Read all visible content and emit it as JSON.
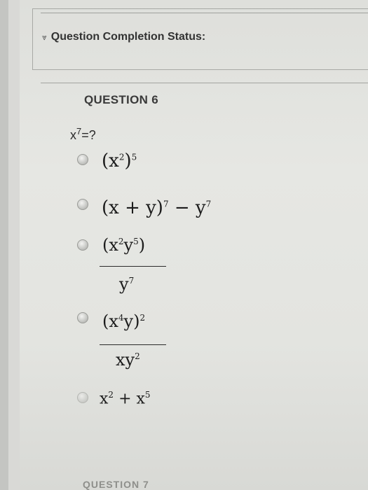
{
  "status": {
    "label": "Question Completion Status:",
    "icon": "chevron-double-down-icon"
  },
  "question": {
    "title": "QUESTION 6",
    "prompt_base": "x",
    "prompt_exp": "7",
    "prompt_tail": "=?"
  },
  "options": [
    {
      "type": "power",
      "base": "(x",
      "inner_exp": "2",
      "close": ")",
      "outer_exp": "5"
    },
    {
      "type": "expr",
      "parts": [
        "(x + y)",
        "7",
        "−",
        "y",
        "7"
      ]
    },
    {
      "type": "fraction",
      "numerator": [
        "(x",
        "2",
        "y",
        "5",
        ")"
      ],
      "denominator": [
        "y",
        "7"
      ]
    },
    {
      "type": "fraction",
      "numerator": [
        "(x",
        "4",
        "y)",
        "2"
      ],
      "denominator": [
        "xy",
        "2"
      ]
    },
    {
      "type": "sum",
      "parts": [
        "x",
        "2",
        "+",
        "x",
        "5"
      ]
    }
  ],
  "footer": {
    "next_title": "QUESTION 7"
  }
}
